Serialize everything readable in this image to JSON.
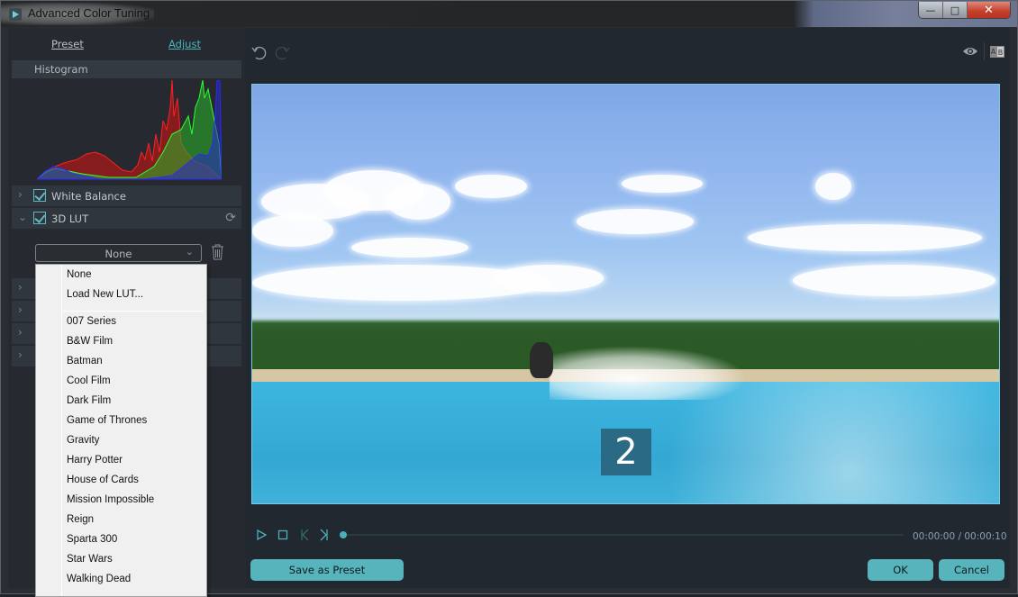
{
  "window": {
    "title": "Advanced Color Tuning",
    "minimize_glyph": "—",
    "maximize_glyph": "□",
    "close_glyph": "✕"
  },
  "left_panel": {
    "tabs": [
      {
        "label": "Preset",
        "active": false
      },
      {
        "label": "Adjust",
        "active": true
      }
    ],
    "histogram": {
      "title": "Histogram"
    },
    "sections": [
      {
        "label": "White Balance",
        "expanded": false,
        "checked": true
      },
      {
        "label": "3D LUT",
        "expanded": true,
        "checked": true
      }
    ],
    "lut": {
      "selected": "None",
      "options": [
        "None",
        "Load New LUT...",
        "007 Series",
        "B&W Film",
        "Batman",
        "Cool Film",
        "Dark Film",
        "Game of Thrones",
        "Gravity",
        "Harry Potter",
        "House of Cards",
        "Mission Impossible",
        "Reign",
        "Sparta 300",
        "Star Wars",
        "Walking Dead"
      ]
    },
    "icons": {
      "collapsed": "›",
      "expanded": "⌄",
      "refresh": "⟳",
      "dropdown_arrow": "⌄"
    }
  },
  "preview": {
    "overlay_counter": "2",
    "accent": "#58b4bc"
  },
  "playback": {
    "current_time": "00:00:00",
    "total_time": "00:00:10",
    "time_display": "00:00:00 / 00:00:10",
    "progress": 0
  },
  "compare": {
    "a": "A",
    "b": "B"
  },
  "buttons": {
    "save_preset": "Save as Preset",
    "ok": "OK",
    "cancel": "Cancel"
  }
}
